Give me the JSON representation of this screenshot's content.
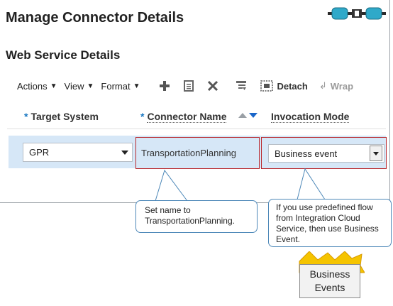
{
  "header": {
    "title": "Manage Connector Details",
    "logo_icon": "integration-connector-icon"
  },
  "section": {
    "title": "Web Service Details"
  },
  "toolbar": {
    "menus": [
      "Actions",
      "View",
      "Format"
    ],
    "icons": [
      "add-icon",
      "copy-icon",
      "delete-icon",
      "filter-icon"
    ],
    "detach_label": "Detach",
    "wrap_label": "Wrap"
  },
  "table": {
    "columns": [
      {
        "label": "Target System",
        "required": "*"
      },
      {
        "label": "Connector Name",
        "required": "*"
      },
      {
        "label": "Invocation Mode",
        "required": ""
      }
    ],
    "rows": [
      {
        "target_system": "GPR",
        "connector_name": "TransportationPlanning",
        "invocation_mode": "Business event"
      }
    ]
  },
  "callouts": {
    "connector": "Set name to TransportationPlanning.",
    "invocation": "If you use predefined flow from Integration Cloud Service, then use Business Event."
  },
  "business_events": {
    "line1": "Business",
    "line2": "Events"
  },
  "colors": {
    "accent": "#1a78c2",
    "highlight": "#b9272c",
    "row_selected": "#d6e7f7",
    "callout_border": "#4d88b8",
    "burst": "#f5c400"
  }
}
